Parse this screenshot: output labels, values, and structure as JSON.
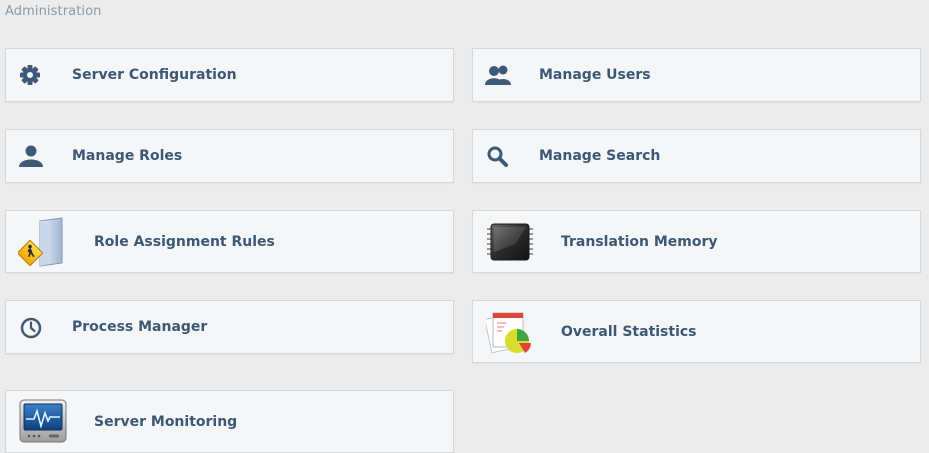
{
  "page": {
    "heading": "Administration"
  },
  "tiles": [
    {
      "label": "Server Configuration",
      "icon": "gear-icon"
    },
    {
      "label": "Manage Users",
      "icon": "users-icon"
    },
    {
      "label": "Manage Roles",
      "icon": "user-icon"
    },
    {
      "label": "Manage Search",
      "icon": "search-icon"
    },
    {
      "label": "Role Assignment Rules",
      "icon": "rules-folder-icon"
    },
    {
      "label": "Translation Memory",
      "icon": "memory-chip-icon"
    },
    {
      "label": "Process Manager",
      "icon": "clock-icon"
    },
    {
      "label": "Overall Statistics",
      "icon": "statistics-chart-icon"
    },
    {
      "label": "Server Monitoring",
      "icon": "monitor-icon"
    }
  ],
  "colors": {
    "label": "#3c5874",
    "icon": "#3d5a78",
    "tile_bg": "#f5f6f7",
    "page_bg": "#ececec"
  }
}
